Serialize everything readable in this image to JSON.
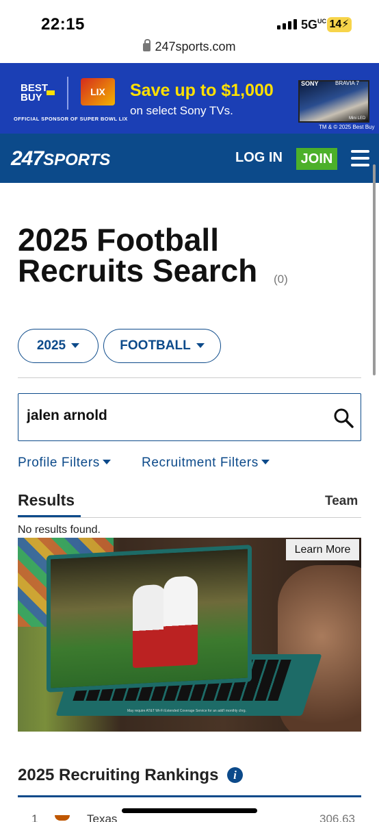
{
  "status_bar": {
    "time": "22:15",
    "network": "5G",
    "network_sup": "UC",
    "battery": "14"
  },
  "browser": {
    "url": "247sports.com"
  },
  "ad_banner": {
    "brand": "BEST BUY",
    "sponsor_text": "OFFICIAL SPONSOR OF SUPER BOWL LIX",
    "superbowl": "LIX",
    "headline": "Save up to $1,000",
    "subline": "on select Sony TVs.",
    "tv_brand": "SONY",
    "tv_model": "BRAVIA 7",
    "tv_tag": "Mini LED",
    "trademark": "TM & © 2025 Best Buy"
  },
  "nav": {
    "logo_247": "247",
    "logo_sports": "SPORTS",
    "login": "LOG IN",
    "join": "JOIN"
  },
  "page": {
    "title": "2025 Football Recruits Search",
    "count": "(0)"
  },
  "filters": {
    "year": "2025",
    "sport": "FOOTBALL",
    "profile_filters": "Profile Filters",
    "recruitment_filters": "Recruitment Filters"
  },
  "search": {
    "value": "jalen arnold",
    "placeholder": ""
  },
  "results": {
    "tab_results": "Results",
    "tab_team": "Team",
    "empty_message": "No results found."
  },
  "video_ad": {
    "cta": "Learn More",
    "disclaimer": "May require AT&T Wi-Fi Extended Coverage Service for an add'l monthly chrg."
  },
  "rankings": {
    "title": "2025 Recruiting Rankings",
    "rows": [
      {
        "rank": "1",
        "team": "Texas",
        "score": "306.63"
      }
    ]
  },
  "colors": {
    "brand_blue": "#0c4a8a",
    "join_green": "#4cb02a",
    "ad_blue": "#1b3fb5",
    "ad_yellow": "#ffe000"
  }
}
